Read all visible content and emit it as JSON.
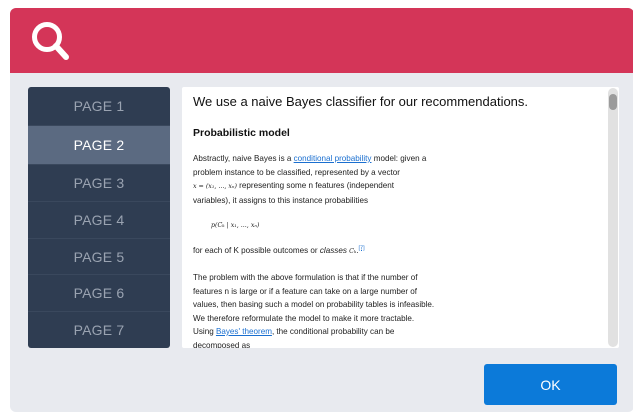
{
  "header": {
    "icon": "search-icon",
    "color": "#d43558"
  },
  "nav": {
    "items": [
      {
        "label": "PAGE 1",
        "active": false
      },
      {
        "label": "PAGE 2",
        "active": true
      },
      {
        "label": "PAGE 3",
        "active": false
      },
      {
        "label": "PAGE 4",
        "active": false
      },
      {
        "label": "PAGE 5",
        "active": false
      },
      {
        "label": "PAGE 6",
        "active": false
      },
      {
        "label": "PAGE 7",
        "active": false
      }
    ]
  },
  "content": {
    "title": "We use a naive Bayes classifier for our recommendations.",
    "section_heading": "Probabilistic model",
    "p1_part1": "Abstractly, naive Bayes is a ",
    "p1_link": "conditional probability",
    "p1_part2": " model: given a",
    "p1_line2": "problem instance to be classified, represented by a vector",
    "p1_vector": "x = (x₁, ..., xₙ)",
    "p1_line3_rest": " representing some n features (independent",
    "p1_line4": "variables), it assigns to this instance probabilities",
    "formula": "p(Cₖ | x₁, ..., xₙ)",
    "p2_text": "for each of K possible outcomes or ",
    "p2_italic": "classes",
    "p2_class": "Cₖ",
    "p2_ref": "[7]",
    "p3_line1": "The problem with the above formulation is that if the number of",
    "p3_line2": "features n is large or if a feature can take on a large number of",
    "p3_line3": "values, then basing such a model on probability tables is infeasible.",
    "p3_line4": "We therefore reformulate the model to make it more tractable.",
    "p3_line5_pre": "Using ",
    "p3_line5_link": "Bayes' theorem",
    "p3_line5_post": ", the conditional probability can be",
    "p3_line6": "decomposed as"
  },
  "footer": {
    "ok_label": "OK"
  },
  "colors": {
    "accent": "#d43558",
    "primary_button": "#0c7ad9",
    "nav_bg": "#2f3d52",
    "nav_active": "#5b6a81",
    "link": "#1a6fd0"
  }
}
